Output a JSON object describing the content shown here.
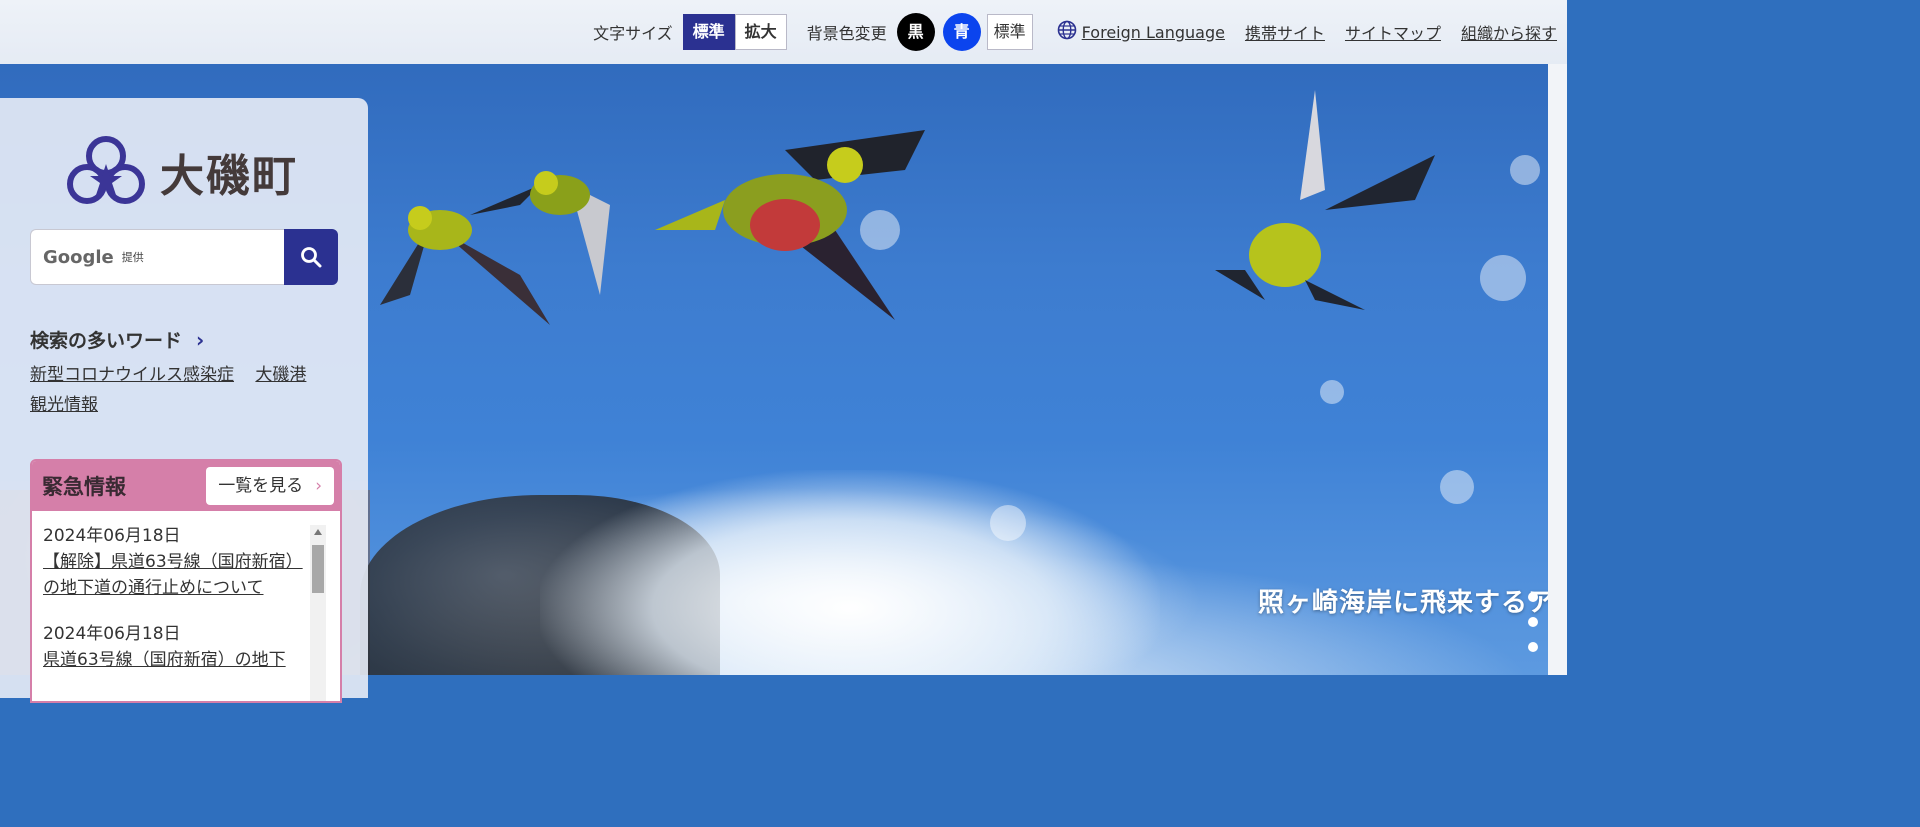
{
  "topbar": {
    "font_size_label": "文字サイズ",
    "font_standard": "標準",
    "font_large": "拡大",
    "bg_color_label": "背景色変更",
    "bg_black": "黒",
    "bg_blue": "青",
    "bg_standard": "標準",
    "links": [
      "Foreign Language",
      "携帯サイト",
      "サイトマップ",
      "組織から探す"
    ]
  },
  "logo": {
    "name": "大磯町"
  },
  "search": {
    "google": "Google",
    "powered": "提供"
  },
  "popular": {
    "title": "検索の多いワード",
    "links": [
      "新型コロナウイルス感染症",
      "大磯港",
      "観光情報"
    ]
  },
  "emergency": {
    "title": "緊急情報",
    "more": "一覧を見る",
    "items": [
      {
        "date": "2024年06月18日",
        "text": "【解除】県道63号線（国府新宿）の地下道の通行止めについて"
      },
      {
        "date": "2024年06月18日",
        "text": "県道63号線（国府新宿）の地下"
      }
    ]
  },
  "hero": {
    "caption": "照ヶ崎海岸に飛来するア"
  },
  "colors": {
    "brand": "#2b3191",
    "emergency": "#d57fa9"
  }
}
